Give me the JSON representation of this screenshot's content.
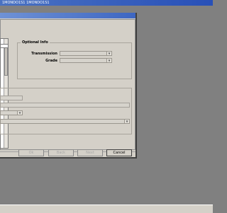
{
  "app": {
    "title_text": "1MONDO1S1 1MONDO1S1"
  },
  "optional_info": {
    "group_title": "Optional Info",
    "transmission_label": "Transmission",
    "grade_label": "Grade"
  },
  "icons": {
    "dropdown_arrow": "chevron-down-icon"
  },
  "buttons": {
    "ok": "Ok",
    "back": "Back",
    "next": "Next",
    "cancel": "Cancel"
  }
}
